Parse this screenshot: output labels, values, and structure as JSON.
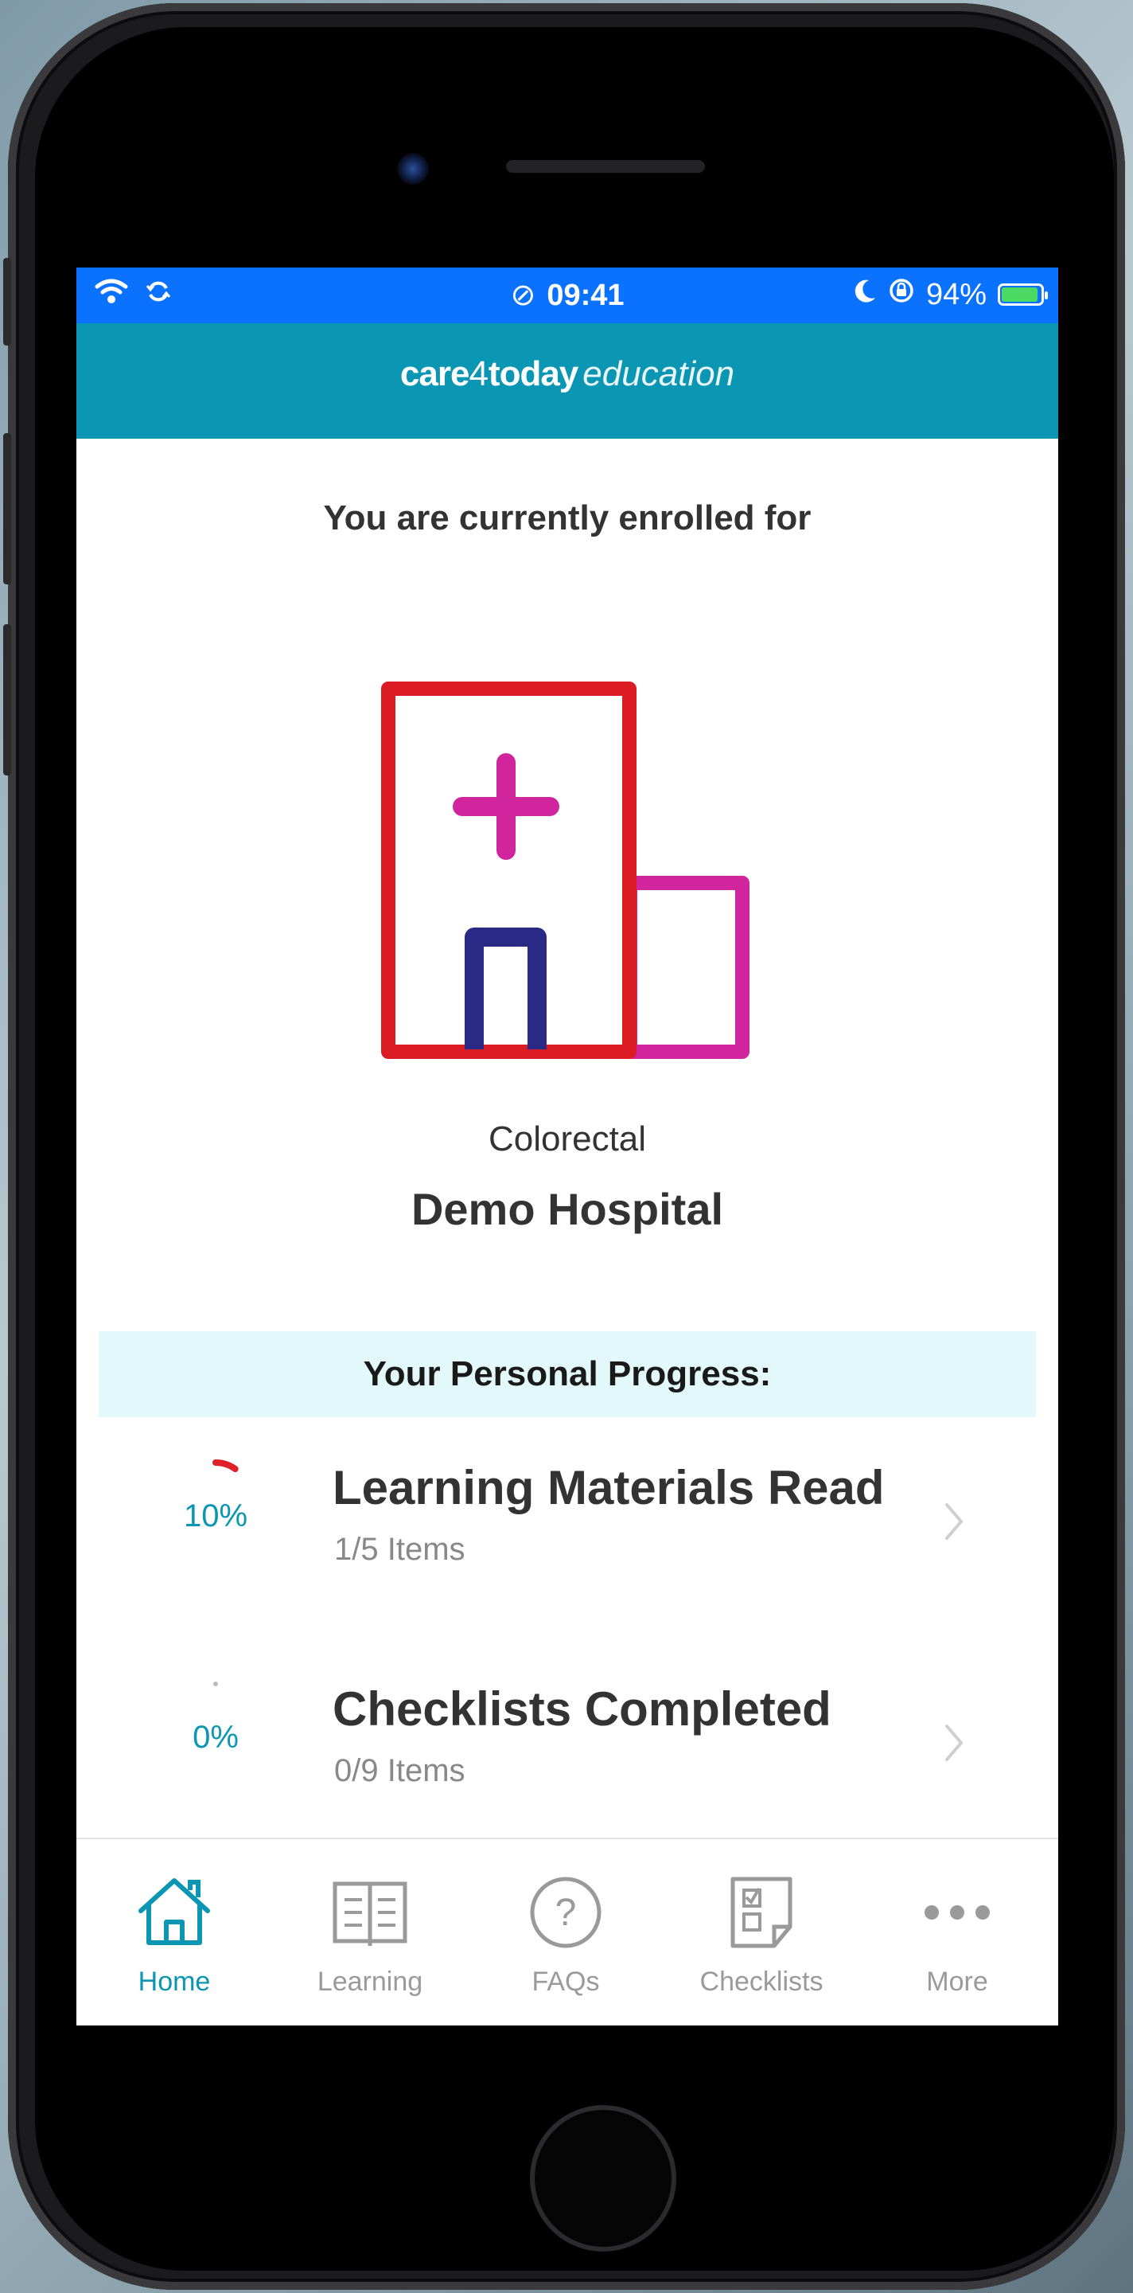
{
  "status_bar": {
    "time": "09:41",
    "battery": "94%",
    "battery_level": 0.94,
    "icons": [
      "wifi-icon",
      "sync-icon",
      "link-icon",
      "moon-icon",
      "orientation-lock-icon",
      "battery-charging-icon"
    ]
  },
  "header": {
    "brand_bold_1": "care",
    "brand_light": "4",
    "brand_bold_2": "today",
    "brand_italic": "education"
  },
  "main": {
    "enrolled_text": "You are currently enrolled for",
    "illustration_icon": "hospital-icon",
    "specialty": "Colorectal",
    "hospital": "Demo Hospital",
    "progress_heading": "Your Personal Progress:"
  },
  "progress": [
    {
      "percent_label": "10%",
      "percent": 0.1,
      "title": "Learning Materials Read",
      "subtitle": "1/5 Items",
      "ring_color": "#e0202a"
    },
    {
      "percent_label": "0%",
      "percent": 0.0,
      "title": "Checklists Completed",
      "subtitle": "0/9 Items",
      "ring_color": "#bbbbbb"
    }
  ],
  "tabs": [
    {
      "label": "Home",
      "icon": "home-icon",
      "active": true
    },
    {
      "label": "Learning",
      "icon": "book-icon",
      "active": false
    },
    {
      "label": "FAQs",
      "icon": "question-icon",
      "active": false
    },
    {
      "label": "Checklists",
      "icon": "checklist-icon",
      "active": false
    },
    {
      "label": "More",
      "icon": "more-icon",
      "active": false
    }
  ],
  "colors": {
    "status_bar": "#0a72ff",
    "header": "#0b96b4",
    "accent": "#0b96b4",
    "progress_band": "#e3f8fb",
    "hospital_red": "#db1c24",
    "hospital_magenta": "#d0259c",
    "hospital_navy": "#2a2a86"
  }
}
